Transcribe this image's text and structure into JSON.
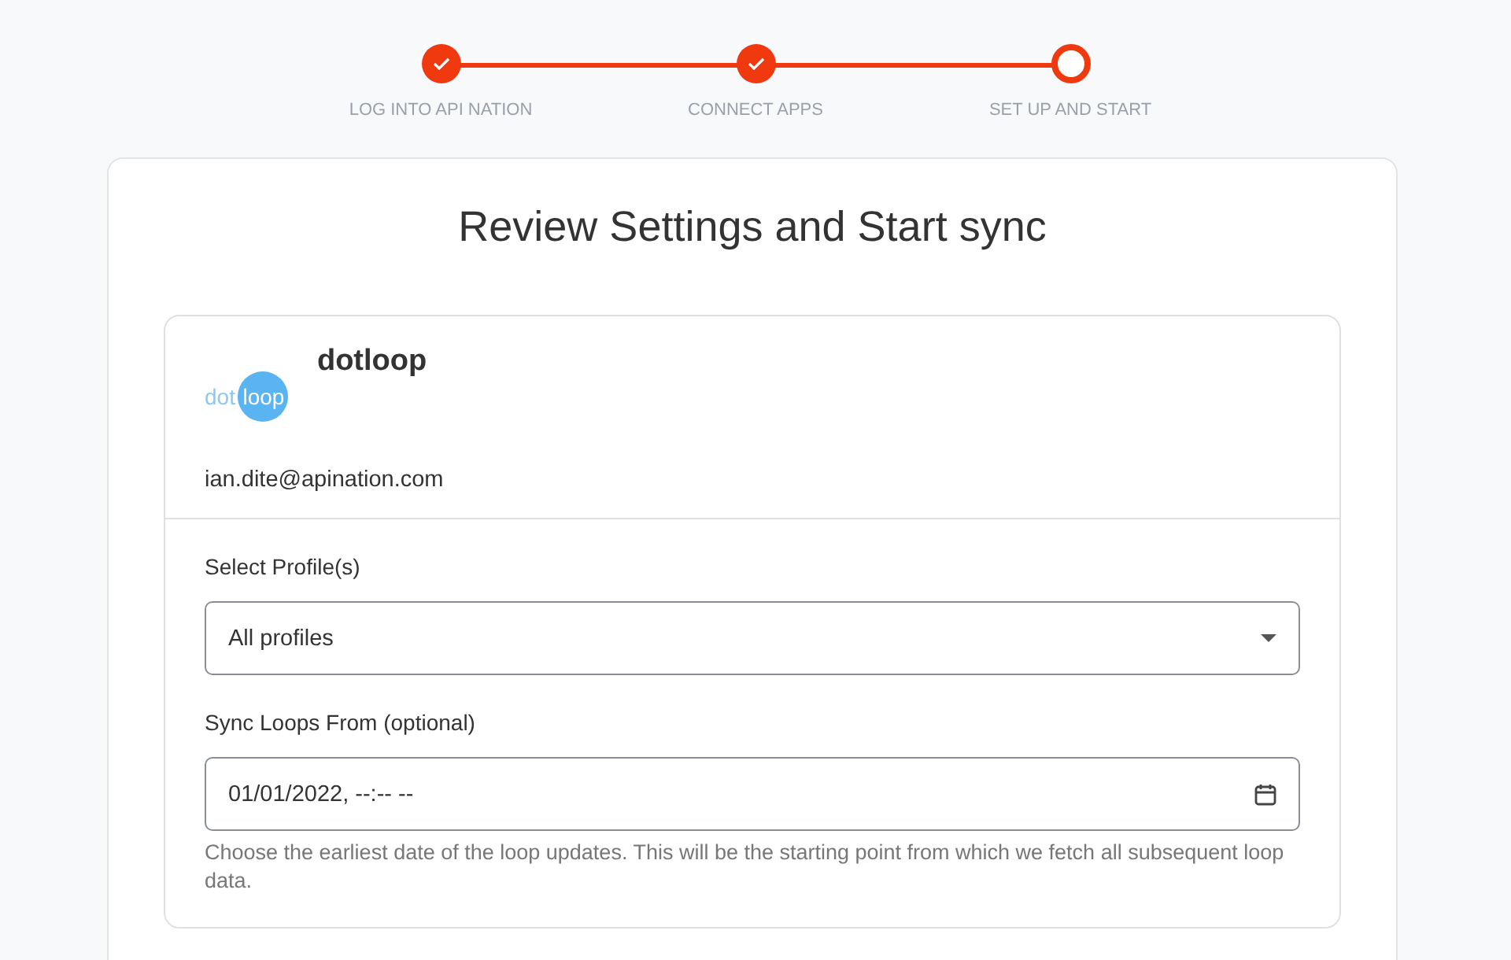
{
  "steps": [
    {
      "label": "LOG INTO API NATION",
      "completed": true
    },
    {
      "label": "CONNECT APPS",
      "completed": true
    },
    {
      "label": "SET UP AND START",
      "completed": false
    }
  ],
  "title": "Review Settings and Start sync",
  "app": {
    "logo_left": "dot",
    "logo_right": "loop",
    "name": "dotloop",
    "account": "ian.dite@apination.com"
  },
  "profile": {
    "label": "Select Profile(s)",
    "value": "All profiles"
  },
  "sync_from": {
    "label": "Sync Loops From (optional)",
    "value": "01/01/2022, --:-- --",
    "help": "Choose the earliest date of the loop updates. This will be the starting point from which we fetch all subsequent loop data."
  }
}
